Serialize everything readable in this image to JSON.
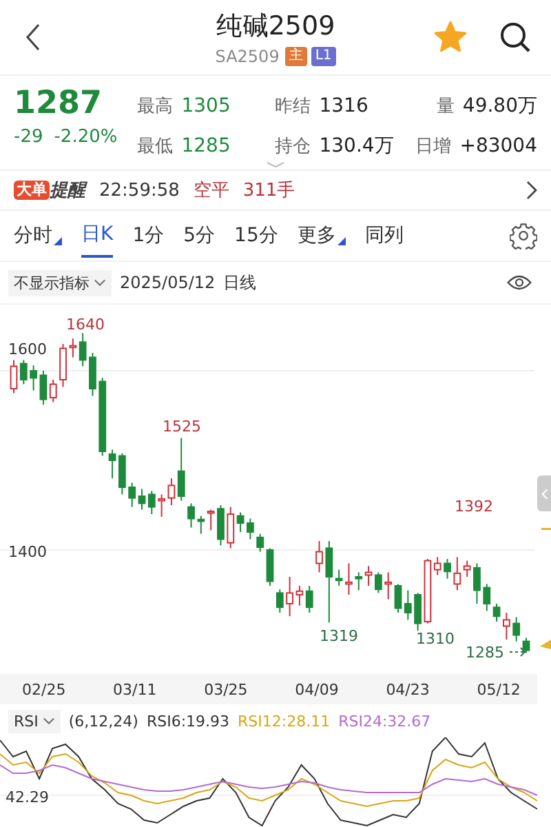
{
  "header": {
    "title": "纯碱2509",
    "code": "SA2509",
    "badges": [
      {
        "label": "主",
        "color": "#e07a3a"
      },
      {
        "label": "L1",
        "color": "#6b6fd0"
      }
    ],
    "favorited": true
  },
  "quote": {
    "price": "1287",
    "change": "-29",
    "change_pct": "-2.20%",
    "falling": true,
    "stats": [
      {
        "label": "最高",
        "value": "1305",
        "falling": true
      },
      {
        "label": "昨结",
        "value": "1316",
        "falling": false
      },
      {
        "label": "量",
        "value": "49.80万",
        "falling": false
      },
      {
        "label": "最低",
        "value": "1285",
        "falling": true
      },
      {
        "label": "持仓",
        "value": "130.4万",
        "falling": false
      },
      {
        "label": "日增",
        "value": "+83004",
        "falling": false
      }
    ]
  },
  "alert": {
    "tag": "大单",
    "title": "提醒",
    "time": "22:59:58",
    "action": "空平",
    "volume": "311手"
  },
  "tabs": [
    {
      "label": "分时",
      "dropdown": true,
      "selected": false
    },
    {
      "label": "日K",
      "dropdown": false,
      "selected": true
    },
    {
      "label": "1分",
      "dropdown": false,
      "selected": false
    },
    {
      "label": "5分",
      "dropdown": false,
      "selected": false
    },
    {
      "label": "15分",
      "dropdown": false,
      "selected": false
    },
    {
      "label": "更多",
      "dropdown": true,
      "selected": false
    },
    {
      "label": "同列",
      "dropdown": false,
      "selected": false
    }
  ],
  "indicator_bar": {
    "indicator": "不显示指标",
    "date": "2025/05/12",
    "period": "日线"
  },
  "chart": {
    "y_labels": [
      "1600",
      "1400"
    ],
    "annotations": [
      {
        "label": "1640",
        "kind": "high"
      },
      {
        "label": "1525",
        "kind": "high"
      },
      {
        "label": "1392",
        "kind": "high"
      },
      {
        "label": "1319",
        "kind": "low"
      },
      {
        "label": "1310",
        "kind": "low"
      },
      {
        "label": "1285",
        "kind": "low"
      }
    ],
    "x_labels": [
      "02/25",
      "03/11",
      "03/25",
      "04/09",
      "04/23",
      "05/12"
    ]
  },
  "rsi": {
    "name": "RSI",
    "params": "(6,12,24)",
    "y_label": "42.29",
    "series": [
      {
        "label": "RSI6:19.93",
        "color": "#333333"
      },
      {
        "label": "RSI12:28.11",
        "color": "#d9a514"
      },
      {
        "label": "RSI24:32.67",
        "color": "#b36ad1"
      }
    ]
  }
}
